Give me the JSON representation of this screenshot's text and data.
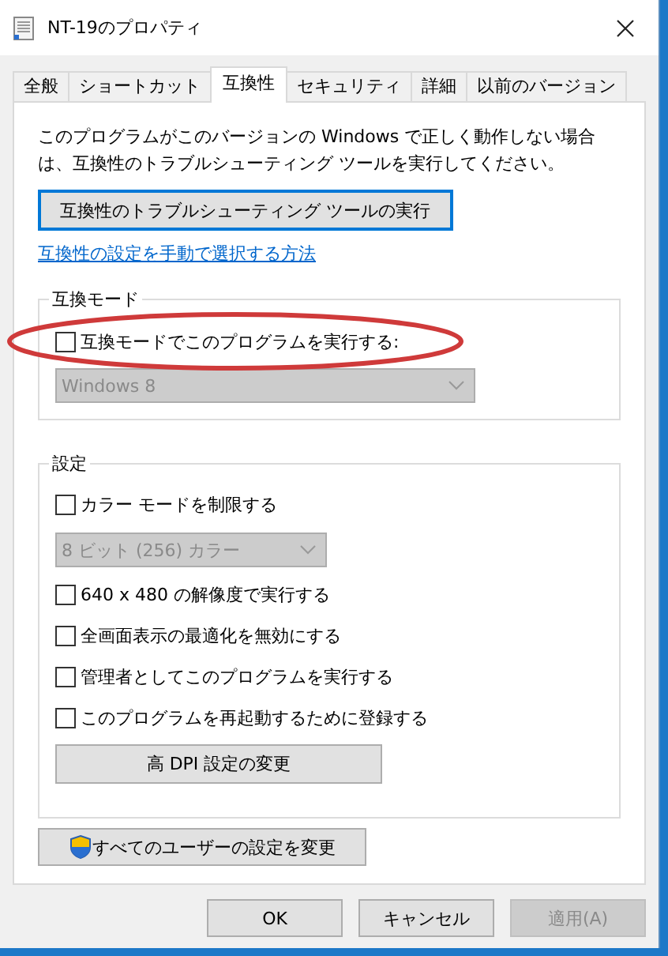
{
  "window": {
    "title": "NT-19のプロパティ"
  },
  "tabs": [
    {
      "label": "全般",
      "selected": false
    },
    {
      "label": "ショートカット",
      "selected": false
    },
    {
      "label": "互換性",
      "selected": true
    },
    {
      "label": "セキュリティ",
      "selected": false
    },
    {
      "label": "詳細",
      "selected": false
    },
    {
      "label": "以前のバージョン",
      "selected": false
    }
  ],
  "description": "このプログラムがこのバージョンの Windows で正しく動作しない場合は、互換性のトラブルシューティング ツールを実行してください。",
  "troubleshoot_button": "互換性のトラブルシューティング ツールの実行",
  "help_link": "互換性の設定を手動で選択する方法",
  "compatibility_mode": {
    "title": "互換モード",
    "annotated": true,
    "checkbox": {
      "label": "互換モードでこのプログラムを実行する:",
      "checked": false
    },
    "dropdown": {
      "value": "Windows 8",
      "disabled": true
    }
  },
  "settings": {
    "title": "設定",
    "items": [
      {
        "kind": "checkbox",
        "label": "カラー モードを制限する",
        "checked": false
      },
      {
        "kind": "dropdown",
        "value": "8 ビット (256) カラー",
        "disabled": true
      },
      {
        "kind": "checkbox",
        "label": "640 x 480 の解像度で実行する",
        "checked": false
      },
      {
        "kind": "checkbox",
        "label": "全画面表示の最適化を無効にする",
        "checked": false
      },
      {
        "kind": "checkbox",
        "label": "管理者としてこのプログラムを実行する",
        "checked": false
      },
      {
        "kind": "checkbox",
        "label": "このプログラムを再起動するために登録する",
        "checked": false
      }
    ],
    "button": "高 DPI 設定の変更"
  },
  "all_users_button": "すべてのユーザーの設定を変更",
  "buttons": [
    {
      "label": "OK",
      "disabled": false
    },
    {
      "label": "キャンセル",
      "disabled": false
    },
    {
      "label": "適用(A)",
      "disabled": true
    }
  ]
}
